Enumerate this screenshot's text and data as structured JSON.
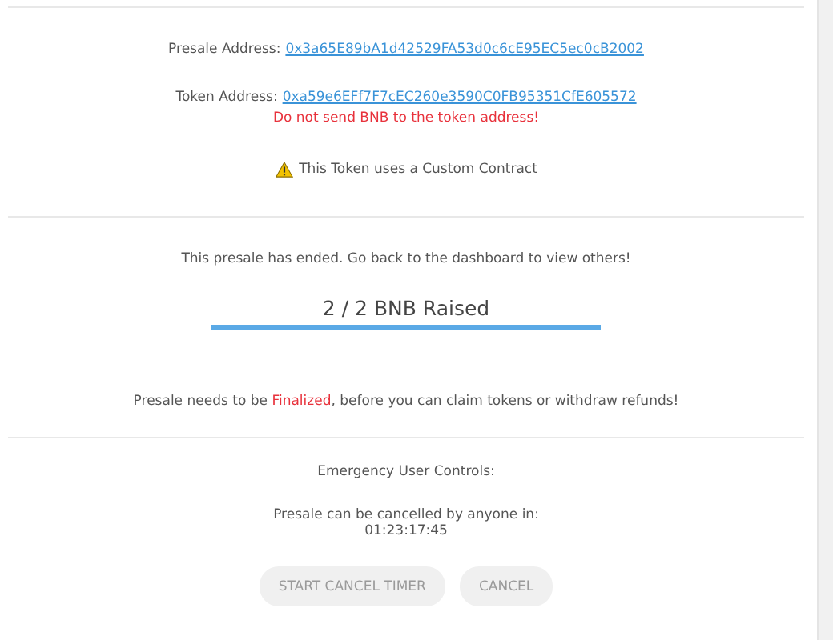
{
  "presale_address": {
    "label": "Presale Address:",
    "value": "0x3a65E89bA1d42529FA53d0c6cE95EC5ec0cB2002"
  },
  "token_address": {
    "label": "Token Address:",
    "value": "0xa59e6EFf7F7cEC260e3590C0FB95351CfE605572",
    "warning": "Do not send BNB to the token address!"
  },
  "contract_notice": "This Token uses a Custom Contract",
  "status": {
    "message": "This presale has ended. Go back to the dashboard to view others!",
    "raised": "2 / 2 BNB Raised",
    "level": 1
  },
  "finalize_notice": [
    {
      "text": "Presale needs to be ",
      "kind": "plain"
    },
    {
      "text": "Finalized",
      "kind": "alert"
    },
    {
      "text": ", before you can claim tokens or withdraw refunds!",
      "kind": "plain"
    }
  ],
  "emergency": {
    "title": "Emergency User Controls:",
    "countdown_label": "Presale can be cancelled by anyone in:",
    "countdown": "01:23:17:45",
    "buttons": [
      {
        "label": "START CANCEL TIMER",
        "disabled": true
      },
      {
        "label": "CANCEL",
        "disabled": true
      }
    ]
  }
}
